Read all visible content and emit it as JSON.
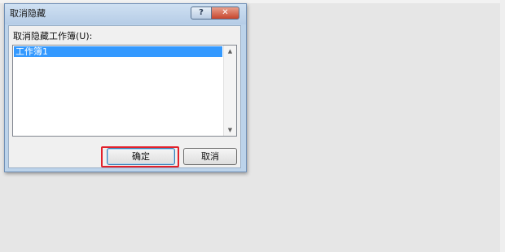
{
  "dialog": {
    "title": "取消隐藏",
    "help_glyph": "?",
    "close_glyph": "✕",
    "list_label": "取消隐藏工作簿(U):",
    "items": [
      "工作簿1"
    ],
    "selected_index": 0,
    "ok_label": "确定",
    "cancel_label": "取消"
  },
  "colors": {
    "selection": "#3399ff",
    "highlight_annotation": "#e2212b",
    "close_button": "#c6452d",
    "desktop": "#e6e6e6"
  },
  "icons": {
    "scroll_up": "scroll-up-arrow-icon",
    "scroll_down": "scroll-down-arrow-icon",
    "help": "help-icon",
    "close": "close-icon"
  }
}
